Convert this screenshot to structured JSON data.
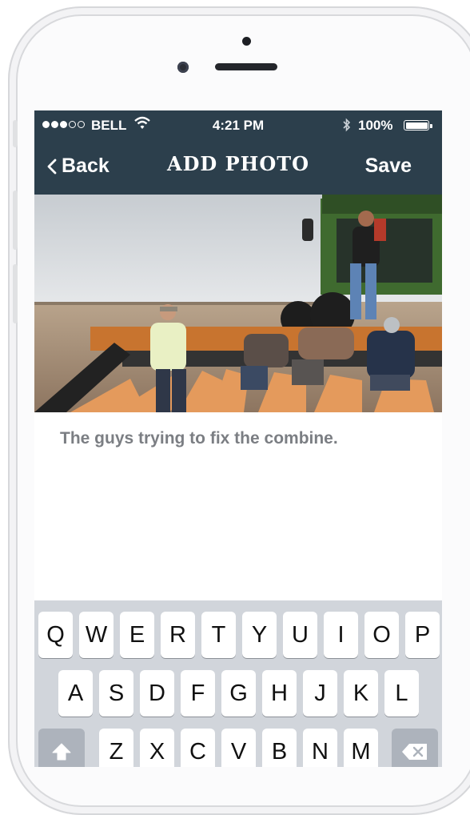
{
  "status_bar": {
    "carrier": "BELL",
    "time": "4:21 PM",
    "bluetooth_icon": "bluetooth-icon",
    "battery": "100%"
  },
  "nav": {
    "back_label": "Back",
    "title": "ADD PHOTO",
    "save_label": "Save"
  },
  "photo": {
    "alt": "Farm workers around a combine harvester header in a field"
  },
  "caption": {
    "text": "The guys trying to fix the combine."
  },
  "keyboard": {
    "row1": [
      "Q",
      "W",
      "E",
      "R",
      "T",
      "Y",
      "U",
      "I",
      "O",
      "P"
    ],
    "row2": [
      "A",
      "S",
      "D",
      "F",
      "G",
      "H",
      "J",
      "K",
      "L"
    ],
    "row3": [
      "Z",
      "X",
      "C",
      "V",
      "B",
      "N",
      "M"
    ],
    "shift_icon": "shift-icon",
    "delete_icon": "delete-icon"
  },
  "colors": {
    "nav_background": "#2c3f4c",
    "keyboard_background": "#d1d5db"
  }
}
